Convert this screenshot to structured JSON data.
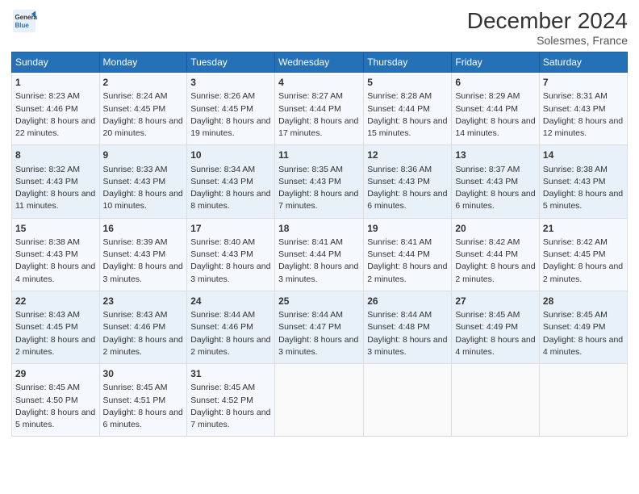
{
  "logo": {
    "line1": "General",
    "line2": "Blue"
  },
  "title": "December 2024",
  "subtitle": "Solesmes, France",
  "days_of_week": [
    "Sunday",
    "Monday",
    "Tuesday",
    "Wednesday",
    "Thursday",
    "Friday",
    "Saturday"
  ],
  "weeks": [
    [
      {
        "day": 1,
        "sunrise": "8:23 AM",
        "sunset": "4:46 PM",
        "daylight": "8 hours and 22 minutes."
      },
      {
        "day": 2,
        "sunrise": "8:24 AM",
        "sunset": "4:45 PM",
        "daylight": "8 hours and 20 minutes."
      },
      {
        "day": 3,
        "sunrise": "8:26 AM",
        "sunset": "4:45 PM",
        "daylight": "8 hours and 19 minutes."
      },
      {
        "day": 4,
        "sunrise": "8:27 AM",
        "sunset": "4:44 PM",
        "daylight": "8 hours and 17 minutes."
      },
      {
        "day": 5,
        "sunrise": "8:28 AM",
        "sunset": "4:44 PM",
        "daylight": "8 hours and 15 minutes."
      },
      {
        "day": 6,
        "sunrise": "8:29 AM",
        "sunset": "4:44 PM",
        "daylight": "8 hours and 14 minutes."
      },
      {
        "day": 7,
        "sunrise": "8:31 AM",
        "sunset": "4:43 PM",
        "daylight": "8 hours and 12 minutes."
      }
    ],
    [
      {
        "day": 8,
        "sunrise": "8:32 AM",
        "sunset": "4:43 PM",
        "daylight": "8 hours and 11 minutes."
      },
      {
        "day": 9,
        "sunrise": "8:33 AM",
        "sunset": "4:43 PM",
        "daylight": "8 hours and 10 minutes."
      },
      {
        "day": 10,
        "sunrise": "8:34 AM",
        "sunset": "4:43 PM",
        "daylight": "8 hours and 8 minutes."
      },
      {
        "day": 11,
        "sunrise": "8:35 AM",
        "sunset": "4:43 PM",
        "daylight": "8 hours and 7 minutes."
      },
      {
        "day": 12,
        "sunrise": "8:36 AM",
        "sunset": "4:43 PM",
        "daylight": "8 hours and 6 minutes."
      },
      {
        "day": 13,
        "sunrise": "8:37 AM",
        "sunset": "4:43 PM",
        "daylight": "8 hours and 6 minutes."
      },
      {
        "day": 14,
        "sunrise": "8:38 AM",
        "sunset": "4:43 PM",
        "daylight": "8 hours and 5 minutes."
      }
    ],
    [
      {
        "day": 15,
        "sunrise": "8:38 AM",
        "sunset": "4:43 PM",
        "daylight": "8 hours and 4 minutes."
      },
      {
        "day": 16,
        "sunrise": "8:39 AM",
        "sunset": "4:43 PM",
        "daylight": "8 hours and 3 minutes."
      },
      {
        "day": 17,
        "sunrise": "8:40 AM",
        "sunset": "4:43 PM",
        "daylight": "8 hours and 3 minutes."
      },
      {
        "day": 18,
        "sunrise": "8:41 AM",
        "sunset": "4:44 PM",
        "daylight": "8 hours and 3 minutes."
      },
      {
        "day": 19,
        "sunrise": "8:41 AM",
        "sunset": "4:44 PM",
        "daylight": "8 hours and 2 minutes."
      },
      {
        "day": 20,
        "sunrise": "8:42 AM",
        "sunset": "4:44 PM",
        "daylight": "8 hours and 2 minutes."
      },
      {
        "day": 21,
        "sunrise": "8:42 AM",
        "sunset": "4:45 PM",
        "daylight": "8 hours and 2 minutes."
      }
    ],
    [
      {
        "day": 22,
        "sunrise": "8:43 AM",
        "sunset": "4:45 PM",
        "daylight": "8 hours and 2 minutes."
      },
      {
        "day": 23,
        "sunrise": "8:43 AM",
        "sunset": "4:46 PM",
        "daylight": "8 hours and 2 minutes."
      },
      {
        "day": 24,
        "sunrise": "8:44 AM",
        "sunset": "4:46 PM",
        "daylight": "8 hours and 2 minutes."
      },
      {
        "day": 25,
        "sunrise": "8:44 AM",
        "sunset": "4:47 PM",
        "daylight": "8 hours and 3 minutes."
      },
      {
        "day": 26,
        "sunrise": "8:44 AM",
        "sunset": "4:48 PM",
        "daylight": "8 hours and 3 minutes."
      },
      {
        "day": 27,
        "sunrise": "8:45 AM",
        "sunset": "4:49 PM",
        "daylight": "8 hours and 4 minutes."
      },
      {
        "day": 28,
        "sunrise": "8:45 AM",
        "sunset": "4:49 PM",
        "daylight": "8 hours and 4 minutes."
      }
    ],
    [
      {
        "day": 29,
        "sunrise": "8:45 AM",
        "sunset": "4:50 PM",
        "daylight": "8 hours and 5 minutes."
      },
      {
        "day": 30,
        "sunrise": "8:45 AM",
        "sunset": "4:51 PM",
        "daylight": "8 hours and 6 minutes."
      },
      {
        "day": 31,
        "sunrise": "8:45 AM",
        "sunset": "4:52 PM",
        "daylight": "8 hours and 7 minutes."
      },
      null,
      null,
      null,
      null
    ]
  ]
}
